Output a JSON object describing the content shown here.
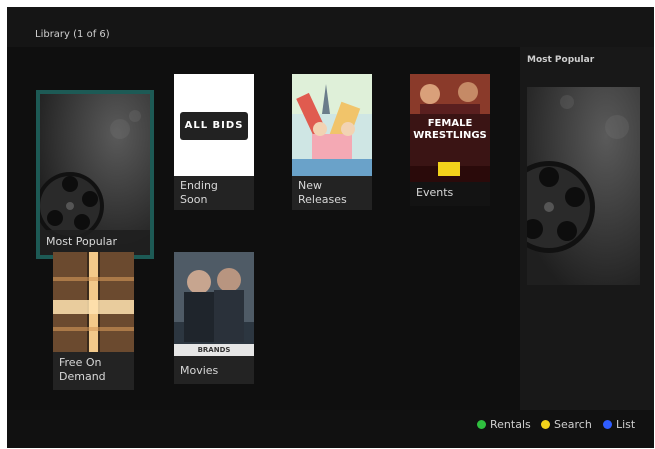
{
  "header": {
    "title": "Library (1 of 6)"
  },
  "tiles": [
    {
      "label": "Most Popular"
    },
    {
      "label": "Ending Soon"
    },
    {
      "label": "New Releases"
    },
    {
      "label": "Events"
    },
    {
      "label": "Free On Demand"
    },
    {
      "label": "Movies"
    }
  ],
  "artwork_text": {
    "ending_soon": "ALL BIDS",
    "events": "FEMALE WRESTLINGS",
    "movies": "BRANDS"
  },
  "side_panel": {
    "title": "Most Popular"
  },
  "footer": {
    "legend": [
      {
        "color": "#2fbf3f",
        "label": "Rentals"
      },
      {
        "color": "#f2d21b",
        "label": "Search"
      },
      {
        "color": "#2f5dff",
        "label": "List"
      }
    ]
  }
}
